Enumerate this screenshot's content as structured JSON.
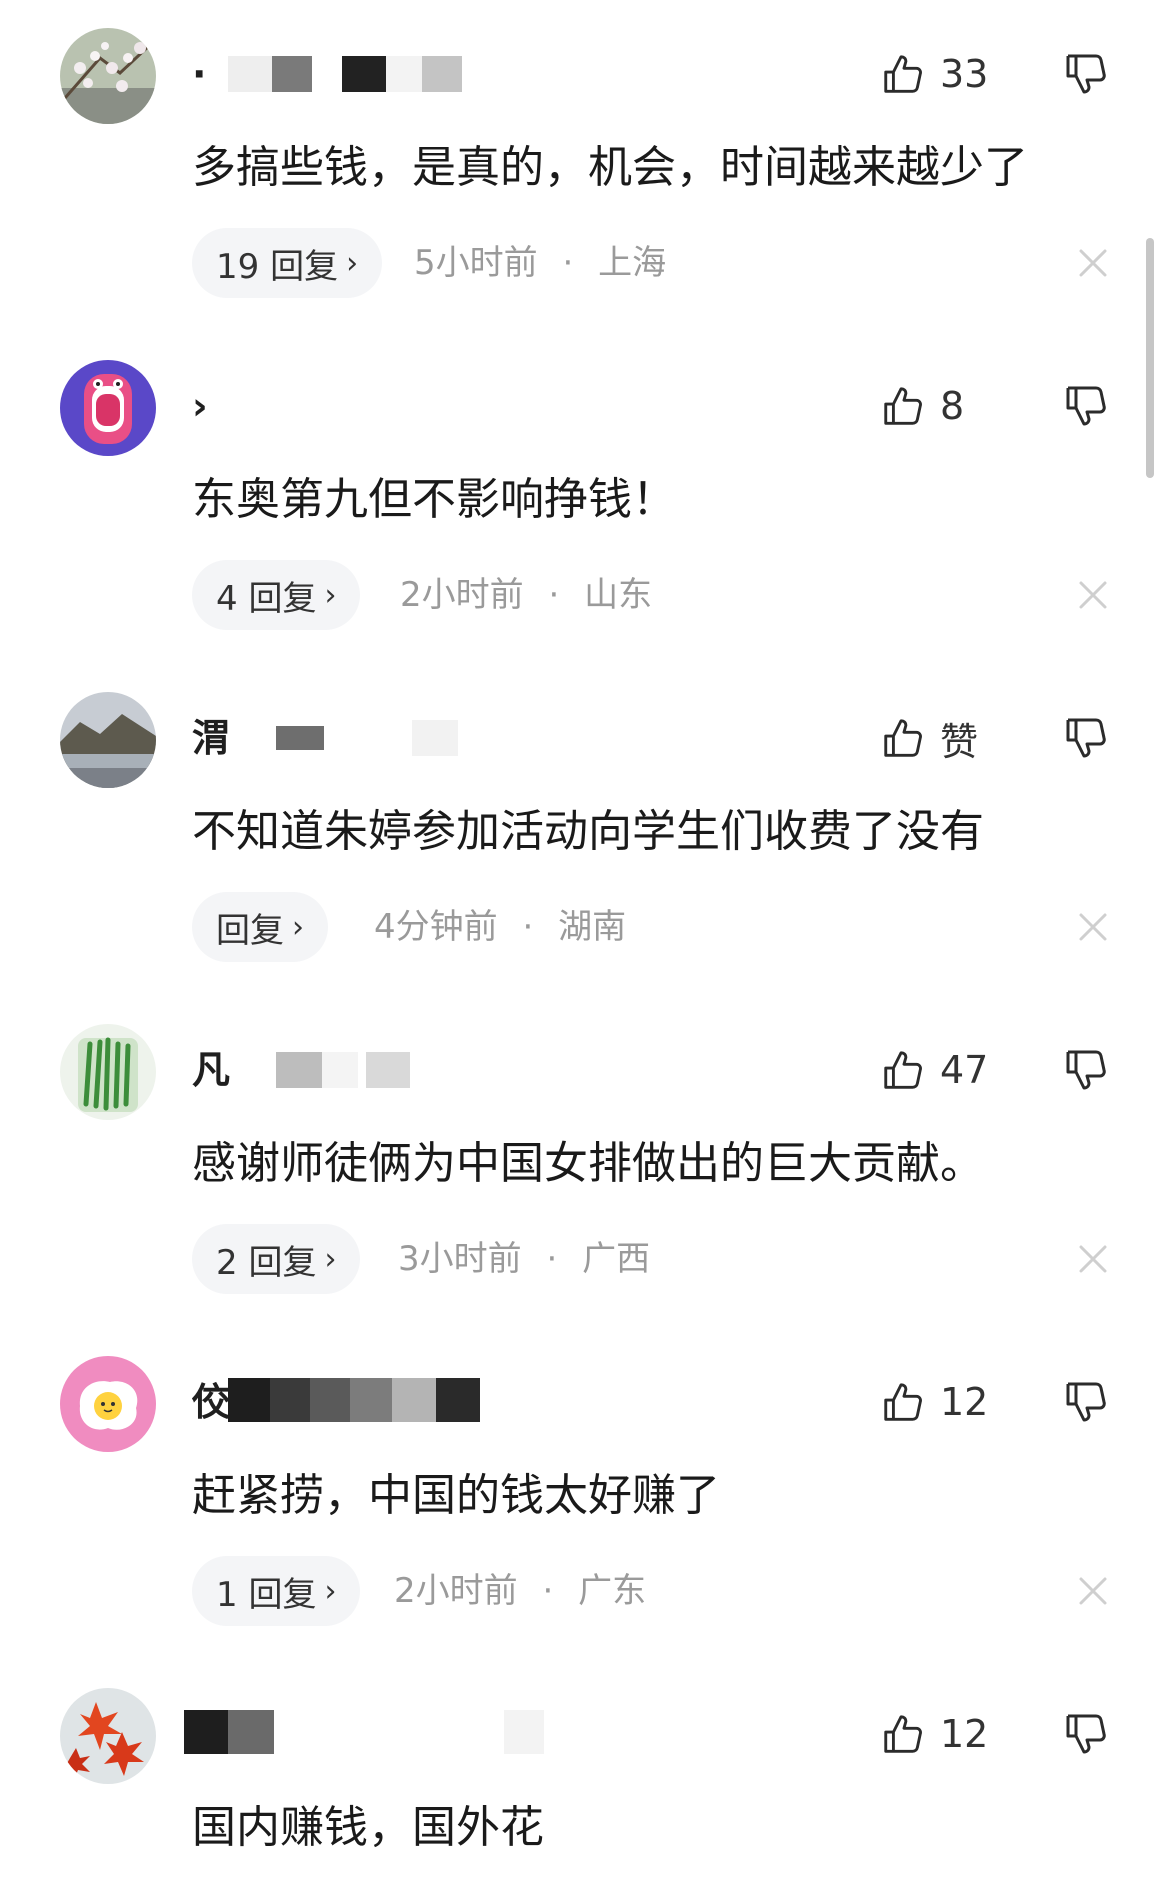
{
  "comments": [
    {
      "username": "·",
      "likes": "33",
      "text": "多搞些钱，是真的，机会，时间越来越少了",
      "reply_label": "19 回复",
      "time": "5小时前",
      "location": "上海",
      "avatar_icon": "plum-blossom-avatar"
    },
    {
      "username": "›",
      "likes": "8",
      "text": "东奥第九但不影响挣钱！",
      "reply_label": "4 回复",
      "time": "2小时前",
      "location": "山东",
      "avatar_icon": "cartoon-mouth-avatar"
    },
    {
      "username": "渭",
      "likes": "赞",
      "text": "不知道朱婷参加活动向学生们收费了没有",
      "reply_label": "回复",
      "time": "4分钟前",
      "location": "湖南",
      "avatar_icon": "landscape-avatar"
    },
    {
      "username": "凡",
      "likes": "47",
      "text": "感谢师徒俩为中国女排做出的巨大贡献。",
      "reply_label": "2 回复",
      "time": "3小时前",
      "location": "广西",
      "avatar_icon": "tea-leaves-avatar"
    },
    {
      "username": "佼",
      "likes": "12",
      "text": "赶紧捞，中国的钱太好赚了",
      "reply_label": "1 回复",
      "time": "2小时前",
      "location": "广东",
      "avatar_icon": "fried-egg-avatar"
    },
    {
      "username": "",
      "likes": "12",
      "text": "国内赚钱，国外花",
      "reply_label": "",
      "time": "",
      "location": "",
      "avatar_icon": "maple-leaves-avatar"
    }
  ],
  "meta_separator": "·",
  "chevron": "›",
  "colors": {
    "text": "#1a1a1a",
    "meta": "#9a9a9a",
    "pill_bg": "#f4f5f7",
    "icon": "#2b2b2b"
  }
}
